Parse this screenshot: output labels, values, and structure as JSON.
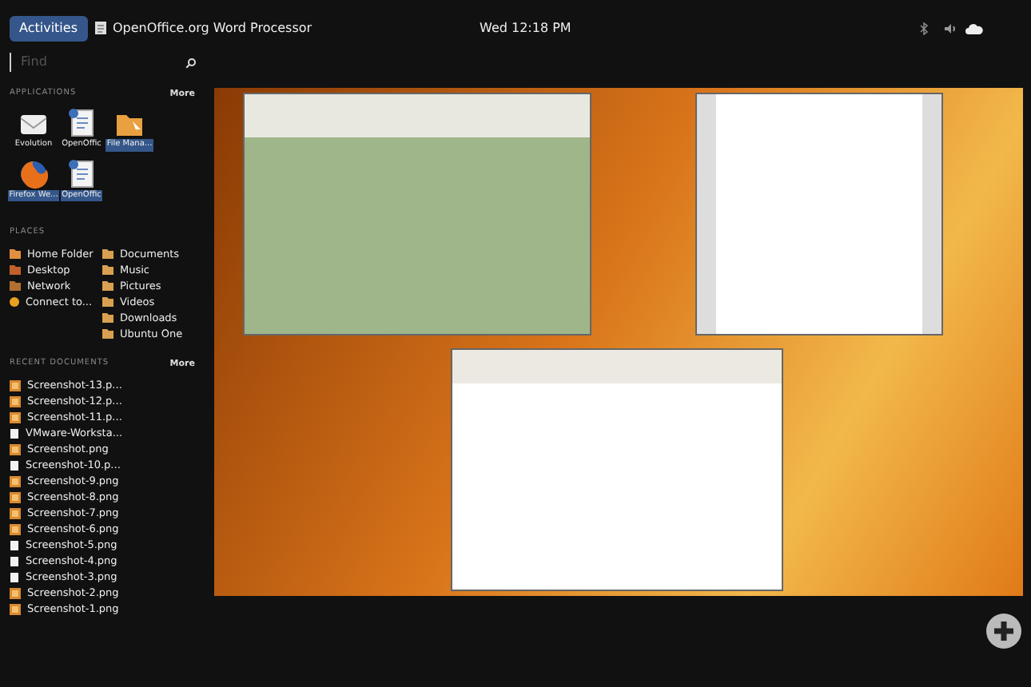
{
  "top_bar": {
    "activities": "Activities",
    "app_name": "OpenOffice.org Word Processor",
    "clock": "Wed 12:18 PM"
  },
  "search": {
    "placeholder": "Find"
  },
  "applications": {
    "title": "APPLICATIONS",
    "more": "More",
    "items": [
      {
        "label": "Evolution",
        "kind": "mail",
        "selected": false
      },
      {
        "label": "OpenOffic",
        "kind": "writer",
        "selected": false
      },
      {
        "label": "File Mana...",
        "kind": "folder",
        "selected": true
      },
      {
        "label": "Firefox We...",
        "kind": "browser",
        "selected": true
      },
      {
        "label": "OpenOffic",
        "kind": "writer",
        "selected": true
      }
    ]
  },
  "places": {
    "title": "PLACES",
    "columns": [
      [
        {
          "label": "Home Folder",
          "kind": "home"
        },
        {
          "label": "Desktop",
          "kind": "desktop"
        },
        {
          "label": "Network",
          "kind": "network"
        },
        {
          "label": "Connect to...",
          "kind": "connect"
        }
      ],
      [
        {
          "label": "Documents",
          "kind": "folder"
        },
        {
          "label": "Music",
          "kind": "folder"
        },
        {
          "label": "Pictures",
          "kind": "folder"
        },
        {
          "label": "Videos",
          "kind": "folder"
        },
        {
          "label": "Downloads",
          "kind": "folder"
        },
        {
          "label": "Ubuntu One",
          "kind": "folder"
        }
      ]
    ]
  },
  "recent_documents": {
    "title": "RECENT DOCUMENTS",
    "more": "More",
    "items": [
      {
        "label": "Screenshot-13.p...",
        "kind": "image"
      },
      {
        "label": "Screenshot-12.p...",
        "kind": "image"
      },
      {
        "label": "Screenshot-11.p...",
        "kind": "image"
      },
      {
        "label": "VMware-Worksta...",
        "kind": "file"
      },
      {
        "label": "Screenshot.png",
        "kind": "image"
      },
      {
        "label": "Screenshot-10.p...",
        "kind": "file"
      },
      {
        "label": "Screenshot-9.png",
        "kind": "image"
      },
      {
        "label": "Screenshot-8.png",
        "kind": "image"
      },
      {
        "label": "Screenshot-7.png",
        "kind": "image"
      },
      {
        "label": "Screenshot-6.png",
        "kind": "image"
      },
      {
        "label": "Screenshot-5.png",
        "kind": "file"
      },
      {
        "label": "Screenshot-4.png",
        "kind": "file"
      },
      {
        "label": "Screenshot-3.png",
        "kind": "file"
      },
      {
        "label": "Screenshot-2.png",
        "kind": "image"
      },
      {
        "label": "Screenshot-1.png",
        "kind": "image"
      }
    ]
  },
  "windows": [
    {
      "kind": "browser"
    },
    {
      "kind": "document"
    },
    {
      "kind": "file_browser"
    }
  ]
}
